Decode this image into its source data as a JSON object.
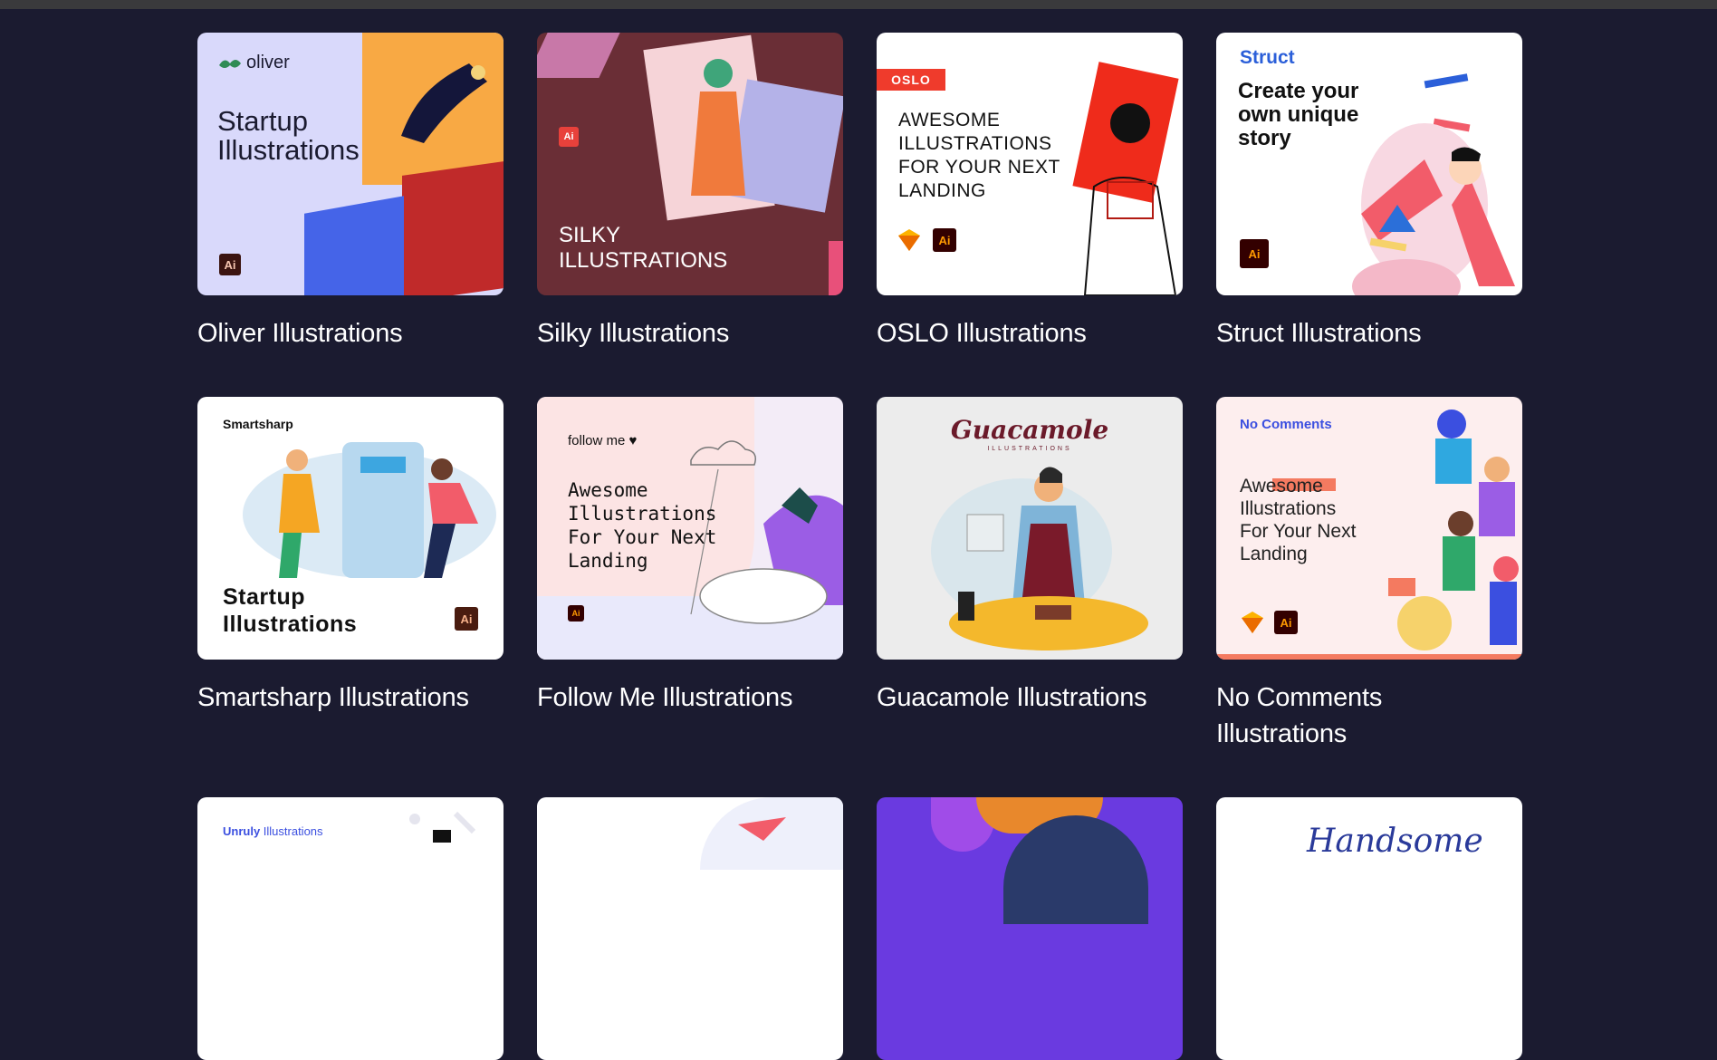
{
  "colors": {
    "background": "#1b1b30",
    "topbar": "#3a3a3c",
    "caption": "#ffffff"
  },
  "cards": [
    {
      "title": "Oliver Illustrations",
      "thumb": {
        "brand": "oliver",
        "headline_1": "Startup",
        "headline_2": "Illustrations",
        "badge": "Ai",
        "bg": "#d9d9fb"
      }
    },
    {
      "title": "Silky Illustrations",
      "thumb": {
        "badge": "Ai",
        "headline_1": "SILKY",
        "headline_2": "ILLUSTRATIONS",
        "bg": "#6a2e36"
      }
    },
    {
      "title": "OSLO Illustrations",
      "thumb": {
        "brand": "OSLO",
        "line_1": "AWESOME",
        "line_2": "ILLUSTRATIONS",
        "line_3": "FOR YOUR NEXT",
        "line_4": "LANDING",
        "badge": "Ai",
        "bg": "#ffffff"
      }
    },
    {
      "title": "Struct Illustrations",
      "thumb": {
        "brand": "Struct",
        "line_1": "Create your",
        "line_2": "own unique",
        "line_3": "story",
        "badge": "Ai",
        "bg": "#ffffff"
      }
    },
    {
      "title": "Smartsharp Illustrations",
      "thumb": {
        "brand": "Smartsharp",
        "headline_1": "Startup",
        "headline_2": "Illustrations",
        "badge": "Ai",
        "bg": "#ffffff"
      }
    },
    {
      "title": "Follow Me Illustrations",
      "thumb": {
        "brand": "follow me ♥",
        "line_1": "Awesome",
        "line_2": "Illustrations",
        "line_3": "For Your Next",
        "line_4": "Landing",
        "badge": "Ai",
        "bg": "#f3ecf7"
      }
    },
    {
      "title": "Guacamole Illustrations",
      "thumb": {
        "brand": "Guacamole",
        "sub": "ILLUSTRATIONS",
        "bg": "#ececec"
      }
    },
    {
      "title": "No Comments Illustrations",
      "title_line_1": "No Comments",
      "title_line_2": "Illustrations",
      "thumb": {
        "brand": "No Comments",
        "line_1": "Awesome",
        "line_2": "Illustrations",
        "line_3": "For Your Next",
        "line_4": "Landing",
        "badge": "Ai",
        "bg": "#fdeeee"
      }
    }
  ],
  "row3": [
    {
      "brand_bold": "Unruly",
      "brand_rest": " Illustrations",
      "bg": "#ffffff"
    },
    {
      "bg": "#ffffff"
    },
    {
      "bg": "#6a3ae0"
    },
    {
      "script": "Handsome",
      "bg": "#ffffff"
    }
  ]
}
